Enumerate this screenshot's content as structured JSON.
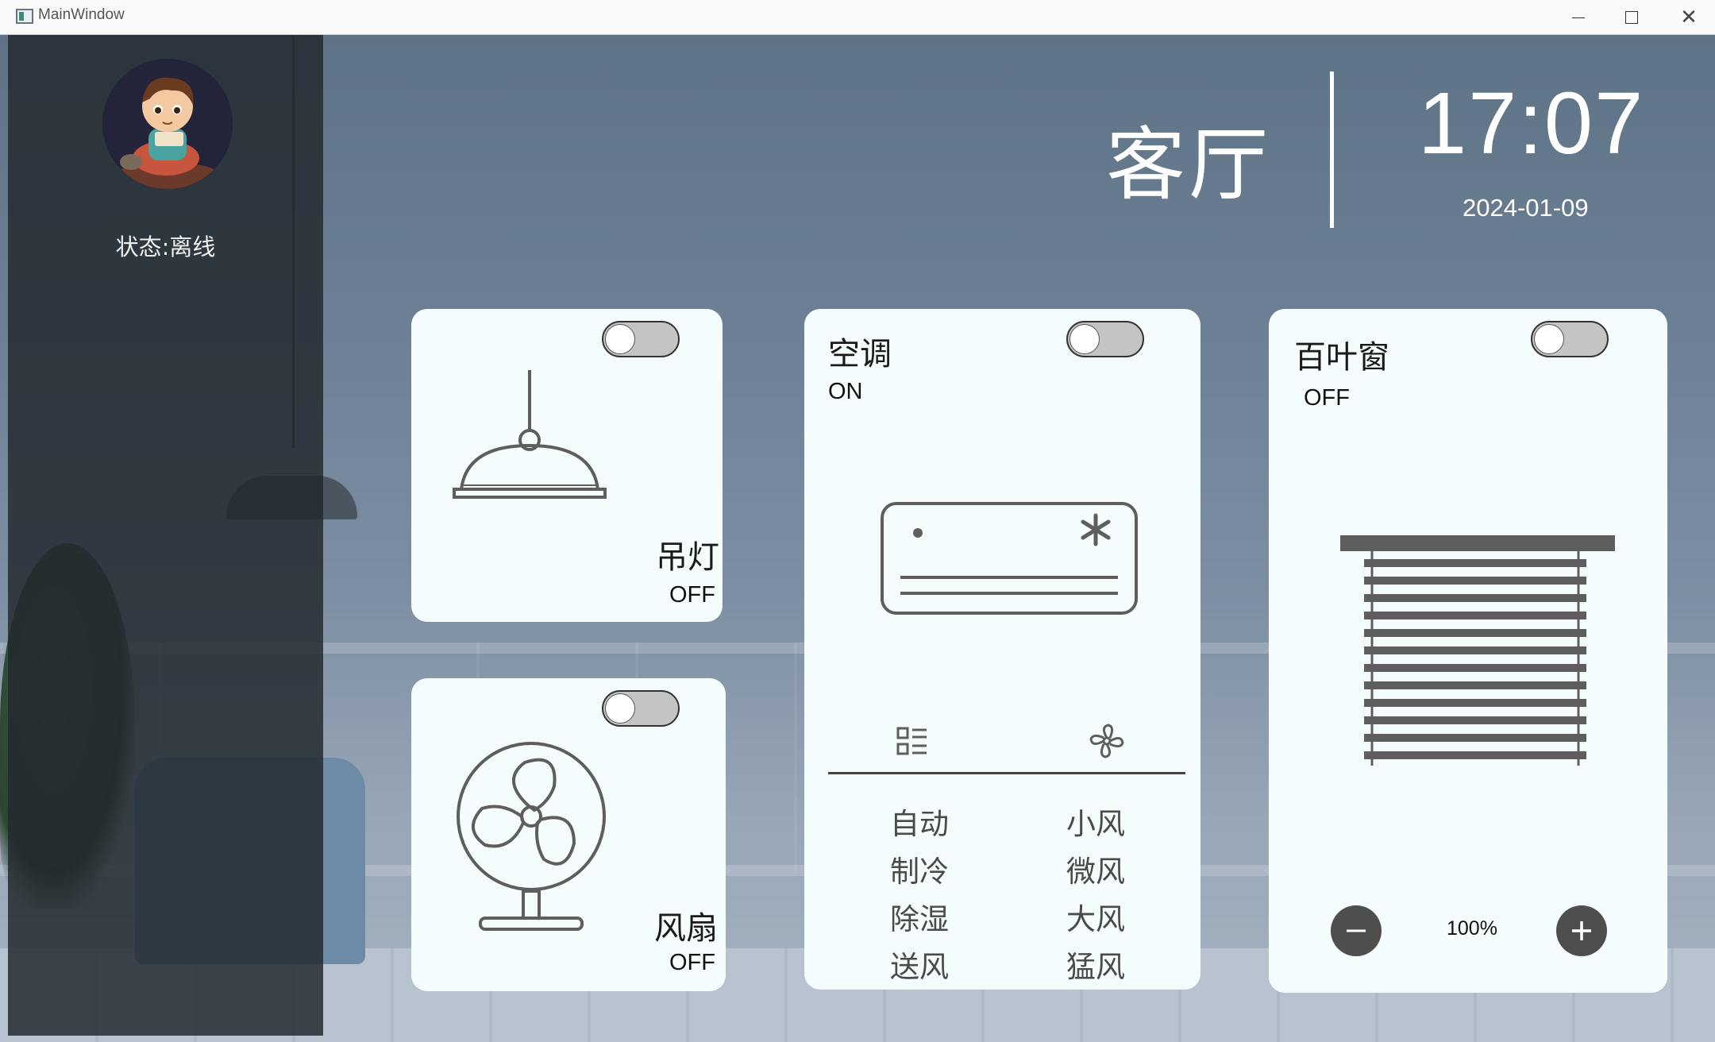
{
  "window": {
    "title": "MainWindow"
  },
  "sidebar": {
    "status": "状态:离线"
  },
  "header": {
    "room": "客厅",
    "time": "17:07",
    "date": "2024-01-09"
  },
  "cards": {
    "pendant_light": {
      "name": "吊灯",
      "state": "OFF",
      "icon": "pendant-lamp-icon"
    },
    "fan": {
      "name": "风扇",
      "state": "OFF",
      "icon": "desk-fan-icon"
    },
    "ac": {
      "name": "空调",
      "state": "ON",
      "icon": "air-conditioner-icon",
      "tabs": [
        "mode-list-icon",
        "fan-speed-icon"
      ],
      "modes": [
        "自动",
        "制冷",
        "除湿",
        "送风"
      ],
      "fan_speeds": [
        "小风",
        "微风",
        "大风",
        "猛风"
      ]
    },
    "blinds": {
      "name": "百叶窗",
      "state": "OFF",
      "icon": "window-blinds-icon",
      "percent": "100%"
    }
  },
  "colors": {
    "card_bg": "#f5fcfe",
    "icon_gray": "#5e5e5e",
    "toggle_off": "#c4c4c4",
    "sidebar": "#22282e"
  }
}
